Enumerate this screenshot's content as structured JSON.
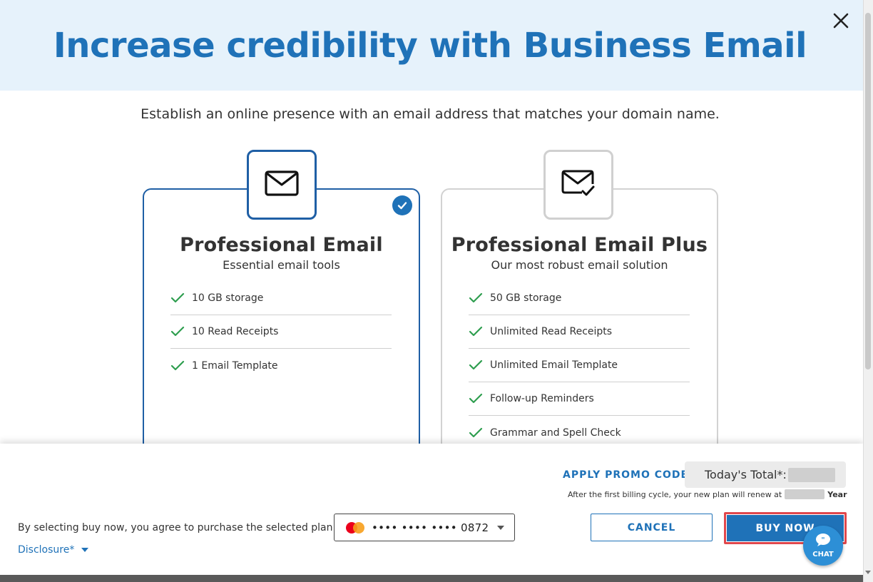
{
  "dialog": {
    "title": "Increase credibility with Business Email",
    "subtitle": "Establish an online presence with an email address that matches your domain name.",
    "close_icon": "close-icon"
  },
  "plans": [
    {
      "name": "Professional Email",
      "description": "Essential email tools",
      "icon": "envelope-icon",
      "selected": true,
      "features": [
        "10 GB storage",
        "10 Read Receipts",
        "1 Email Template"
      ]
    },
    {
      "name": "Professional Email Plus",
      "description": "Our most robust email solution",
      "icon": "envelope-check-icon",
      "selected": false,
      "features": [
        "50 GB storage",
        "Unlimited Read Receipts",
        "Unlimited Email Template",
        "Follow-up Reminders",
        "Grammar and Spell Check"
      ]
    }
  ],
  "footer": {
    "promo_label": "APPLY PROMO CODE",
    "total_label": "Today's Total*:",
    "renew_text": "After the first billing cycle, your new plan will renew at",
    "renew_period": "Year",
    "agree_text": "By selecting buy now, you agree to purchase the selected plan with",
    "payment_card": "•••• •••• •••• 0872",
    "disclosure_label": "Disclosure*",
    "cancel_label": "CANCEL",
    "buy_label": "BUY NOW",
    "chat_label": "CHAT"
  },
  "colors": {
    "brand_blue": "#1f72b8",
    "header_bg": "#e6f2fb",
    "check_green": "#2e9e4f",
    "highlight_red": "#e0474c"
  }
}
